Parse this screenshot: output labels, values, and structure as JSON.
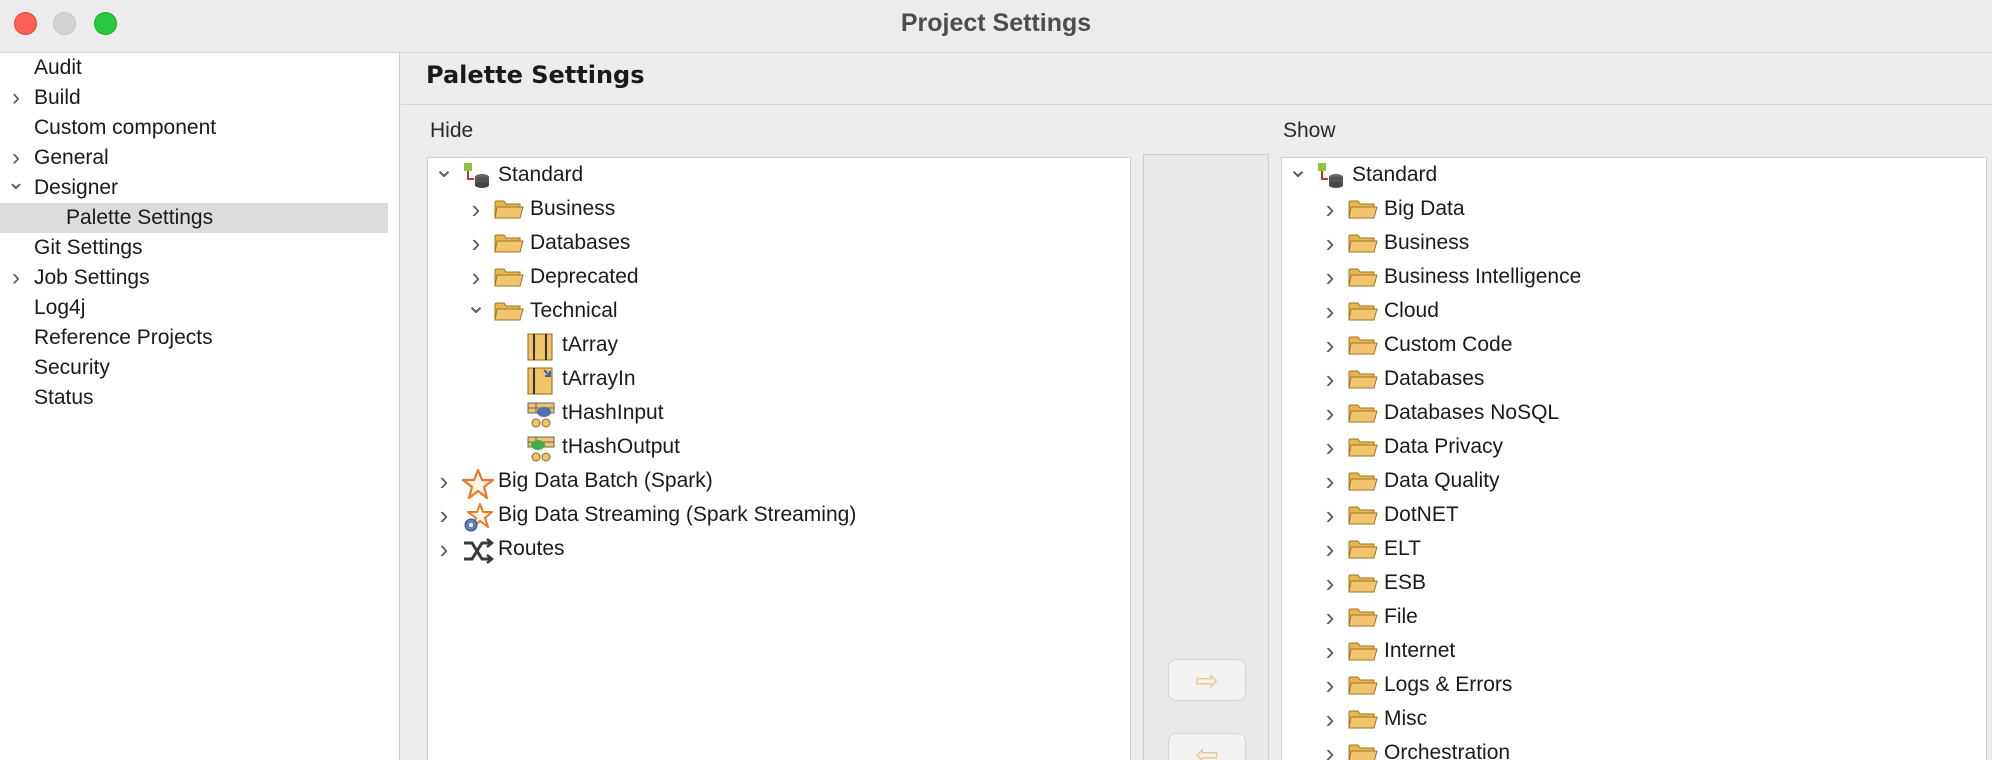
{
  "window": {
    "title": "Project Settings"
  },
  "sidebar": {
    "items": [
      {
        "label": "Audit",
        "chevron": ""
      },
      {
        "label": "Build",
        "chevron": "right"
      },
      {
        "label": "Custom component",
        "chevron": ""
      },
      {
        "label": "General",
        "chevron": "right"
      },
      {
        "label": "Designer",
        "chevron": "down"
      },
      {
        "label": "Palette Settings",
        "chevron": "",
        "child": true,
        "selected": true
      },
      {
        "label": "Git Settings",
        "chevron": ""
      },
      {
        "label": "Job Settings",
        "chevron": "right"
      },
      {
        "label": "Log4j",
        "chevron": ""
      },
      {
        "label": "Reference Projects",
        "chevron": ""
      },
      {
        "label": "Security",
        "chevron": ""
      },
      {
        "label": "Status",
        "chevron": ""
      }
    ]
  },
  "main": {
    "title": "Palette Settings",
    "hide_label": "Hide",
    "show_label": "Show",
    "move_right_icon": "arrow-right-icon",
    "move_left_icon": "arrow-left-icon",
    "hide_tree": [
      {
        "label": "Standard",
        "level": 0,
        "twisty": "down",
        "icon": "palette-root-icon"
      },
      {
        "label": "Business",
        "level": 1,
        "twisty": "right",
        "icon": "folder-icon"
      },
      {
        "label": "Databases",
        "level": 1,
        "twisty": "right",
        "icon": "folder-icon"
      },
      {
        "label": "Deprecated",
        "level": 1,
        "twisty": "right",
        "icon": "folder-icon"
      },
      {
        "label": "Technical",
        "level": 1,
        "twisty": "down",
        "icon": "folder-icon"
      },
      {
        "label": "tArray",
        "level": 2,
        "twisty": "",
        "icon": "component-array-icon"
      },
      {
        "label": "tArrayIn",
        "level": 2,
        "twisty": "",
        "icon": "component-array-in-icon"
      },
      {
        "label": "tHashInput",
        "level": 2,
        "twisty": "",
        "icon": "component-hash-input-icon"
      },
      {
        "label": "tHashOutput",
        "level": 2,
        "twisty": "",
        "icon": "component-hash-output-icon"
      },
      {
        "label": "Big Data Batch (Spark)",
        "level": 0,
        "twisty": "right",
        "icon": "spark-star-icon"
      },
      {
        "label": "Big Data Streaming (Spark Streaming)",
        "level": 0,
        "twisty": "right",
        "icon": "spark-streaming-icon"
      },
      {
        "label": "Routes",
        "level": 0,
        "twisty": "right",
        "icon": "routes-icon"
      }
    ],
    "show_tree": [
      {
        "label": "Standard",
        "level": 0,
        "twisty": "down",
        "icon": "palette-root-icon"
      },
      {
        "label": "Big Data",
        "level": 1,
        "twisty": "right",
        "icon": "folder-icon"
      },
      {
        "label": "Business",
        "level": 1,
        "twisty": "right",
        "icon": "folder-icon"
      },
      {
        "label": "Business Intelligence",
        "level": 1,
        "twisty": "right",
        "icon": "folder-icon"
      },
      {
        "label": "Cloud",
        "level": 1,
        "twisty": "right",
        "icon": "folder-icon"
      },
      {
        "label": "Custom Code",
        "level": 1,
        "twisty": "right",
        "icon": "folder-icon"
      },
      {
        "label": "Databases",
        "level": 1,
        "twisty": "right",
        "icon": "folder-icon"
      },
      {
        "label": "Databases NoSQL",
        "level": 1,
        "twisty": "right",
        "icon": "folder-icon"
      },
      {
        "label": "Data Privacy",
        "level": 1,
        "twisty": "right",
        "icon": "folder-icon"
      },
      {
        "label": "Data Quality",
        "level": 1,
        "twisty": "right",
        "icon": "folder-icon"
      },
      {
        "label": "DotNET",
        "level": 1,
        "twisty": "right",
        "icon": "folder-icon"
      },
      {
        "label": "ELT",
        "level": 1,
        "twisty": "right",
        "icon": "folder-icon"
      },
      {
        "label": "ESB",
        "level": 1,
        "twisty": "right",
        "icon": "folder-icon"
      },
      {
        "label": "File",
        "level": 1,
        "twisty": "right",
        "icon": "folder-icon"
      },
      {
        "label": "Internet",
        "level": 1,
        "twisty": "right",
        "icon": "folder-icon"
      },
      {
        "label": "Logs & Errors",
        "level": 1,
        "twisty": "right",
        "icon": "folder-icon"
      },
      {
        "label": "Misc",
        "level": 1,
        "twisty": "right",
        "icon": "folder-icon"
      },
      {
        "label": "Orchestration",
        "level": 1,
        "twisty": "right",
        "icon": "folder-icon"
      }
    ]
  },
  "colors": {
    "close": "#fe5f57",
    "minimize": "#d3d3d3",
    "maximize": "#28c840",
    "selection": "#dcdcdc",
    "folder": "#f2c46d",
    "arrow": "#e7c98a"
  }
}
